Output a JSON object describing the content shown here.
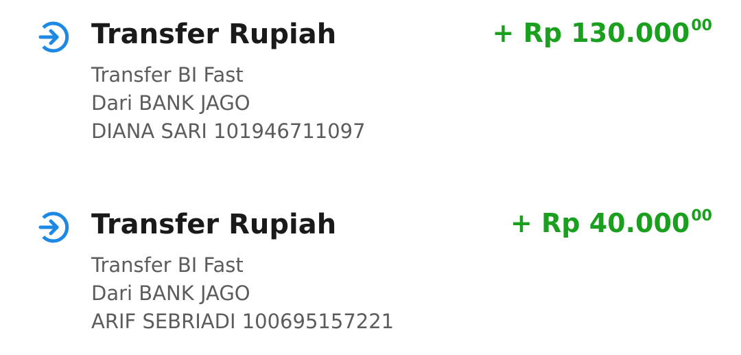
{
  "colors": {
    "icon_blue": "#1e88e5",
    "amount_green": "#1aa01e",
    "title_text": "#1a1a1a",
    "detail_text": "#5c5c5c"
  },
  "transactions": [
    {
      "icon": "incoming-transfer-icon",
      "title": "Transfer Rupiah",
      "amount": "+ Rp 130.000",
      "amount_cents": "00",
      "method": "Transfer BI Fast",
      "source_bank": "Dari BANK JAGO",
      "sender": "DIANA SARI 101946711097"
    },
    {
      "icon": "incoming-transfer-icon",
      "title": "Transfer Rupiah",
      "amount": "+ Rp 40.000",
      "amount_cents": "00",
      "method": "Transfer BI Fast",
      "source_bank": "Dari BANK JAGO",
      "sender": "ARIF SEBRIADI 100695157221"
    }
  ]
}
